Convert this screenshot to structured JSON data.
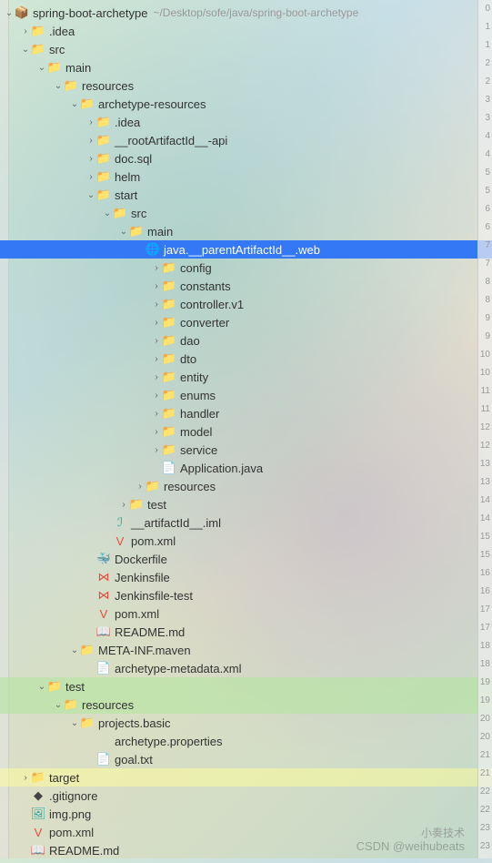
{
  "root": {
    "name": "spring-boot-archetype",
    "path": "~/Desktop/sofe/java/spring-boot-archetype"
  },
  "tree": [
    {
      "d": 0,
      "ch": "v",
      "ic": "📦",
      "c": "#c792ea",
      "t": "spring-boot-archetype",
      "path": "~/Desktop/sofe/java/spring-boot-archetype",
      "hl": ""
    },
    {
      "d": 1,
      "ch": ">",
      "ic": "📁",
      "c": "#e9a94b",
      "t": ".idea"
    },
    {
      "d": 1,
      "ch": "v",
      "ic": "📁",
      "c": "#4a9eff",
      "t": "src"
    },
    {
      "d": 2,
      "ch": "v",
      "ic": "📁",
      "c": "#444",
      "t": "main"
    },
    {
      "d": 3,
      "ch": "v",
      "ic": "📁",
      "c": "#c792ea",
      "t": "resources"
    },
    {
      "d": 4,
      "ch": "v",
      "ic": "📁",
      "c": "#444",
      "t": "archetype-resources"
    },
    {
      "d": 5,
      "ch": ">",
      "ic": "📁",
      "c": "#4a9eff",
      "t": ".idea"
    },
    {
      "d": 5,
      "ch": ">",
      "ic": "📁",
      "c": "#444",
      "t": "__rootArtifactId__-api"
    },
    {
      "d": 5,
      "ch": ">",
      "ic": "📁",
      "c": "#4a9eff",
      "t": "doc.sql"
    },
    {
      "d": 5,
      "ch": ">",
      "ic": "📁",
      "c": "#4a9eff",
      "t": "helm"
    },
    {
      "d": 5,
      "ch": "v",
      "ic": "📁",
      "c": "#444",
      "t": "start"
    },
    {
      "d": 6,
      "ch": "v",
      "ic": "📁",
      "c": "#4a9eff",
      "t": "src"
    },
    {
      "d": 7,
      "ch": "v",
      "ic": "📁",
      "c": "#444",
      "t": "main"
    },
    {
      "d": 8,
      "ch": "",
      "ic": "🌐",
      "c": "#4a9eff",
      "t": "java.__parentArtifactId__.web",
      "sel": true
    },
    {
      "d": 9,
      "ch": ">",
      "ic": "📁",
      "c": "#26a69a",
      "t": "config"
    },
    {
      "d": 9,
      "ch": ">",
      "ic": "📁",
      "c": "#444",
      "t": "constants"
    },
    {
      "d": 9,
      "ch": ">",
      "ic": "📁",
      "c": "#444",
      "t": "controller.v1"
    },
    {
      "d": 9,
      "ch": ">",
      "ic": "📁",
      "c": "#444",
      "t": "converter"
    },
    {
      "d": 9,
      "ch": ">",
      "ic": "📁",
      "c": "#26a69a",
      "t": "dao"
    },
    {
      "d": 9,
      "ch": ">",
      "ic": "📁",
      "c": "#26a69a",
      "t": "dto"
    },
    {
      "d": 9,
      "ch": ">",
      "ic": "📁",
      "c": "#444",
      "t": "entity"
    },
    {
      "d": 9,
      "ch": ">",
      "ic": "📁",
      "c": "#444",
      "t": "enums"
    },
    {
      "d": 9,
      "ch": ">",
      "ic": "📁",
      "c": "#444",
      "t": "handler"
    },
    {
      "d": 9,
      "ch": ">",
      "ic": "📁",
      "c": "#26a69a",
      "t": "model"
    },
    {
      "d": 9,
      "ch": ">",
      "ic": "📁",
      "c": "#26a69a",
      "t": "service"
    },
    {
      "d": 9,
      "ch": "",
      "ic": "📄",
      "c": "#999",
      "t": "Application.java"
    },
    {
      "d": 8,
      "ch": ">",
      "ic": "📁",
      "c": "#c792ea",
      "t": "resources"
    },
    {
      "d": 7,
      "ch": ">",
      "ic": "📁",
      "c": "#26a69a",
      "t": "test"
    },
    {
      "d": 6,
      "ch": "",
      "ic": "ℐ",
      "c": "#26a69a",
      "t": "__artifactId__.iml"
    },
    {
      "d": 6,
      "ch": "",
      "ic": "V",
      "c": "#e74c3c",
      "t": "pom.xml"
    },
    {
      "d": 5,
      "ch": "",
      "ic": "🐳",
      "c": "#4a9eff",
      "t": "Dockerfile"
    },
    {
      "d": 5,
      "ch": "",
      "ic": "⋈",
      "c": "#e74c3c",
      "t": "Jenkinsfile"
    },
    {
      "d": 5,
      "ch": "",
      "ic": "⋈",
      "c": "#e74c3c",
      "t": "Jenkinsfile-test"
    },
    {
      "d": 5,
      "ch": "",
      "ic": "V",
      "c": "#e74c3c",
      "t": "pom.xml"
    },
    {
      "d": 5,
      "ch": "",
      "ic": "📖",
      "c": "#444",
      "t": "README.md"
    },
    {
      "d": 4,
      "ch": "v",
      "ic": "📁",
      "c": "#c2185b",
      "t": "META-INF.maven"
    },
    {
      "d": 5,
      "ch": "",
      "ic": "📄",
      "c": "#666",
      "t": "archetype-metadata.xml"
    },
    {
      "d": 2,
      "ch": "v",
      "ic": "📁",
      "c": "#26a69a",
      "t": "test",
      "hl": "2"
    },
    {
      "d": 3,
      "ch": "v",
      "ic": "📁",
      "c": "#c792ea",
      "t": "resources",
      "hl": "2"
    },
    {
      "d": 4,
      "ch": "v",
      "ic": "📁",
      "c": "#444",
      "t": "projects.basic"
    },
    {
      "d": 5,
      "ch": "",
      "ic": "</>",
      "c": "#4a9eff",
      "t": "archetype.properties"
    },
    {
      "d": 5,
      "ch": "",
      "ic": "📄",
      "c": "#666",
      "t": "goal.txt"
    },
    {
      "d": 1,
      "ch": ">",
      "ic": "📁",
      "c": "#e9a94b",
      "t": "target",
      "hl": "1"
    },
    {
      "d": 1,
      "ch": "",
      "ic": "◆",
      "c": "#444",
      "t": ".gitignore"
    },
    {
      "d": 1,
      "ch": "",
      "ic": "🖼",
      "c": "#26a69a",
      "t": "img.png"
    },
    {
      "d": 1,
      "ch": "",
      "ic": "V",
      "c": "#e74c3c",
      "t": "pom.xml"
    },
    {
      "d": 1,
      "ch": "",
      "ic": "📖",
      "c": "#4a9eff",
      "t": "README.md"
    }
  ],
  "watermark1": "小奏技术",
  "watermark2": "CSDN @weihubeats"
}
